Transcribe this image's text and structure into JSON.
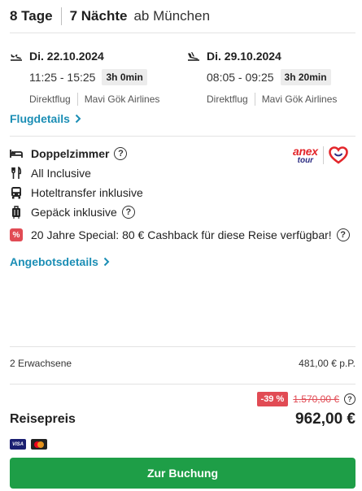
{
  "header": {
    "days": "8 Tage",
    "nights": "7 Nächte",
    "departure": "ab München"
  },
  "outbound": {
    "date": "Di. 22.10.2024",
    "times": "11:25 - 15:25",
    "duration": "3h 0min",
    "type": "Direktflug",
    "airline": "Mavi Gök Airlines",
    "icon": "plane-takeoff-icon"
  },
  "return": {
    "date": "Di. 29.10.2024",
    "times": "08:05 - 09:25",
    "duration": "3h 20min",
    "type": "Direktflug",
    "airline": "Mavi Gök Airlines",
    "icon": "plane-landing-icon"
  },
  "flight_details_link": "Flugdetails",
  "features": {
    "room": "Doppelzimmer",
    "board": "All Inclusive",
    "transfer": "Hoteltransfer inklusive",
    "luggage": "Gepäck inklusive",
    "special": "20 Jahre Special: 80 € Cashback für diese Reise verfügbar!",
    "special_badge": "%"
  },
  "operator": {
    "name_top": "anex",
    "name_bottom": "tour"
  },
  "offer_details_link": "Angebotsdetails",
  "travellers": {
    "label": "2 Erwachsene",
    "price_per_person": "481,00 € p.P."
  },
  "pricing": {
    "discount": "-39 %",
    "old_price": "1.570,00 €",
    "total_label": "Reisepreis",
    "total": "962,00 €"
  },
  "payment_methods": {
    "visa": "VISA"
  },
  "book_button": "Zur Buchung",
  "colors": {
    "link": "#1b8eb5",
    "discount": "#e14b54",
    "book": "#1e9e47"
  }
}
